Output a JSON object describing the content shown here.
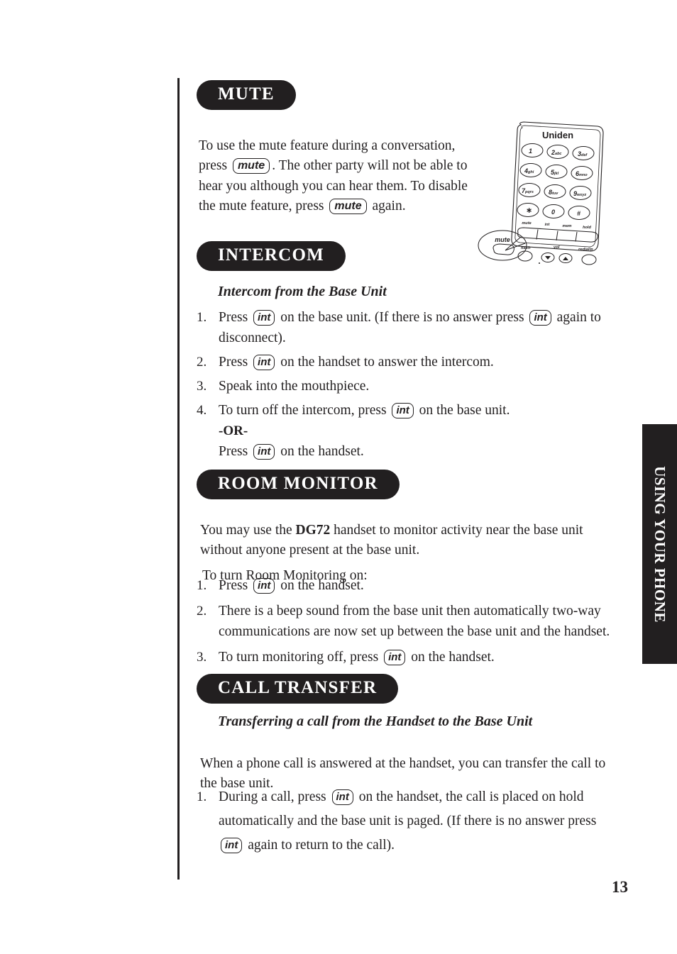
{
  "page": {
    "number": "13",
    "side_tab_label": "USING YOUR PHONE"
  },
  "sections": {
    "mute": {
      "heading": "MUTE",
      "paragraph_part1": "To use the mute feature during a conversation, press",
      "key1": "mute",
      "paragraph_part2": ". The other party will not be able to hear you although you can hear them. To disable the mute feature, press",
      "key2": "mute",
      "paragraph_part3": "again."
    },
    "intercom": {
      "heading": "INTERCOM",
      "subheading": "Intercom from the Base Unit",
      "steps": [
        {
          "number": "1.",
          "text_a": "Press",
          "key_a": "int",
          "text_b": "on the base unit. (If there is no answer press",
          "key_b": "int",
          "text_c": "again to disconnect)."
        },
        {
          "number": "2.",
          "text_a": "Press",
          "key_a": "int",
          "text_b": "on the handset to answer the intercom."
        },
        {
          "number": "3.",
          "text_a": "Speak into the mouthpiece."
        },
        {
          "number": "4.",
          "text_a": "To turn off the intercom, press",
          "key_a": "int",
          "text_b": "on the base unit.",
          "or_label": "-OR-",
          "text_c": "Press",
          "key_b": "int",
          "text_d": "on the handset."
        }
      ]
    },
    "room_monitor": {
      "heading": "ROOM MONITOR",
      "intro_part1": "You may use the",
      "model": "DG72",
      "intro_part2": "handset to monitor activity near the base unit without anyone present at the base unit.",
      "lead_in": "To turn Room Monitoring on:",
      "steps": [
        {
          "number": "1.",
          "text_a": "Press",
          "key_a": "int",
          "text_b": "on the handset."
        },
        {
          "number": "2.",
          "text_a": "There is a beep sound from the base unit then automatically two-way communications are now set up between the base unit and the handset."
        },
        {
          "number": "3.",
          "text_a": "To turn monitoring off, press",
          "key_a": "int",
          "text_b": "on the handset."
        }
      ]
    },
    "call_transfer": {
      "heading": "CALL TRANSFER",
      "subheading": "Transferring a call from the Handset to the Base Unit",
      "intro": "When a phone call is answered at the handset, you can transfer the call to the base unit.",
      "steps": [
        {
          "number": "1.",
          "text_a": "During a call, press",
          "key_a": "int",
          "text_b": "on the handset, the call is placed on hold automatically and the base unit is paged. (If there is no answer press",
          "key_b": "int",
          "text_c": "again to return to the call)."
        }
      ]
    }
  },
  "illustration": {
    "name": "base-unit-keypad-diagram",
    "brand": "Uniden",
    "keys": [
      {
        "digit": "1",
        "letters": ""
      },
      {
        "digit": "2",
        "letters": "abc"
      },
      {
        "digit": "3",
        "letters": "def"
      },
      {
        "digit": "4",
        "letters": "ghi"
      },
      {
        "digit": "5",
        "letters": "jkl"
      },
      {
        "digit": "6",
        "letters": "mno"
      },
      {
        "digit": "7",
        "letters": "pqrs"
      },
      {
        "digit": "8",
        "letters": "tuv"
      },
      {
        "digit": "9",
        "letters": "wxyz"
      },
      {
        "digit": "∗",
        "letters": ""
      },
      {
        "digit": "0",
        "letters": ""
      },
      {
        "digit": "#",
        "letters": ""
      }
    ],
    "bar_labels": [
      "mute",
      "int",
      "mem",
      "hold"
    ],
    "bottom_labels": {
      "left": "flash",
      "center": "vol",
      "right": "redial/p"
    },
    "callout_label": "mute"
  }
}
